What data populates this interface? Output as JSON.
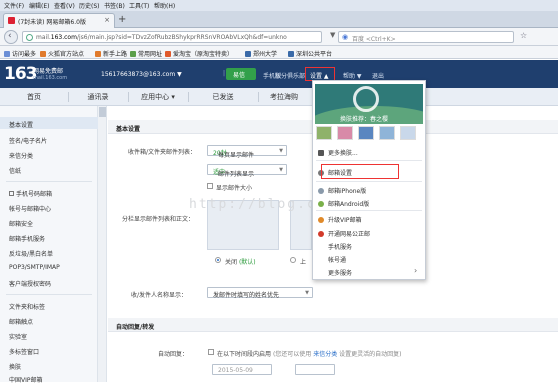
{
  "browser": {
    "menu": [
      "文件(F)",
      "编辑(E)",
      "查看(V)",
      "历史(S)",
      "书签(B)",
      "工具(T)",
      "帮助(H)"
    ],
    "tab_title": "(7封未读) 网易邮箱6.0版",
    "new_tab": "+",
    "url_prefix": "mail.",
    "url_domain": "163.com",
    "url_path": "/js6/main.jsp?sid=TDvzZofRubzBShykprRRSnVROAbVLxQh&df=unkno",
    "url_controls": "▼ C",
    "search_placeholder": "百度 <Ctrl+K>",
    "bookmarks": [
      {
        "label": "访问最多",
        "color": "#6b8fd6"
      },
      {
        "label": "火狐官方站点",
        "color": "#e07a2c"
      },
      {
        "label": "新手上路",
        "color": "#e07a2c"
      },
      {
        "label": "常用网址",
        "color": "#5b9f4a"
      },
      {
        "label": "爱淘宝（原淘宝特卖）",
        "color": "#e05a2c"
      },
      {
        "label": "郑州大学",
        "color": "#3a6aa8"
      },
      {
        "label": "深圳公共平台",
        "color": "#3a6aa8"
      }
    ]
  },
  "mail_header": {
    "logo": "163",
    "logo_sub1": "网易免费邮",
    "logo_sub2": "mail.163.com",
    "account": "15617663873@163.com ▼",
    "app_button": "易信",
    "links": [
      "手机版",
      "积分俱乐部",
      "设置 ▲",
      "帮助 ▼",
      "退出"
    ]
  },
  "mail_nav": {
    "tabs": [
      "首页",
      "通讯录",
      "应用中心 ▾",
      "已发送",
      "考拉海购"
    ]
  },
  "sidebar": {
    "items_top": [
      "基本设置",
      "签名/电子名片",
      "来信分类",
      "信纸"
    ],
    "items_mid": [
      "手机号码邮箱",
      "帐号与邮箱中心",
      "邮箱安全",
      "邮箱手机服务",
      "反垃圾/黑白名单",
      "POP3/SMTP/IMAP",
      "客户端授权密码"
    ],
    "items_bottom": [
      "文件夹和标签",
      "邮箱触点",
      "实验室",
      "多标签窗口",
      "换肤",
      "中国VIP邮箱"
    ]
  },
  "content": {
    "section1_title": "基本设置",
    "row1_label": "收件箱/文件夹邮件列表：",
    "select1_prefix": "每页显示邮件",
    "select1_value": "20封",
    "select2_prefix": "邮件列表显示",
    "select2_value": "适中",
    "checkbox1": "显示邮件大小",
    "row2_label": "分栏显示邮件列表和正文：",
    "radio1": "关闭",
    "radio1_suffix": "(默认)",
    "radio2": "上",
    "row3_label": "收/发件人名称显示：",
    "select3": "发邮件时填写的姓名优先",
    "section2_title": "自动回复/转发",
    "row4_label": "自动回复：",
    "checkbox2_prefix": "在以下时间段内启用",
    "checkbox2_note": "(您还可以使用",
    "checkbox2_link": "来信分类",
    "checkbox2_suffix": "设置更灵活的自动回复)",
    "date": "2015-05-09",
    "watermark": "http://blog.csdn.net/"
  },
  "dropdown": {
    "skin_caption": "换肤推荐：春之樱",
    "thumb_colors": [
      "#8fb26a",
      "#d88aa8",
      "#5a86c0",
      "#8fb4d8",
      "#c9d8ea"
    ],
    "items": [
      {
        "label": "更多换肤...",
        "icon_color": "#555"
      },
      {
        "label": "邮箱设置",
        "icon_color": "#777"
      },
      {
        "label": "邮箱iPhone版",
        "icon_color": "#8a9aaa"
      },
      {
        "label": "邮箱Android版",
        "icon_color": "#7ab04a"
      },
      {
        "label": "升级VIP邮箱",
        "icon_color": "#e08a2a"
      },
      {
        "label": "开通网易公正邮",
        "icon_color": "#d23a2a"
      },
      {
        "label": "手机服务",
        "icon_color": ""
      },
      {
        "label": "帐号通",
        "icon_color": ""
      },
      {
        "label": "更多服务",
        "icon_color": ""
      }
    ],
    "more_arrow": "›"
  }
}
